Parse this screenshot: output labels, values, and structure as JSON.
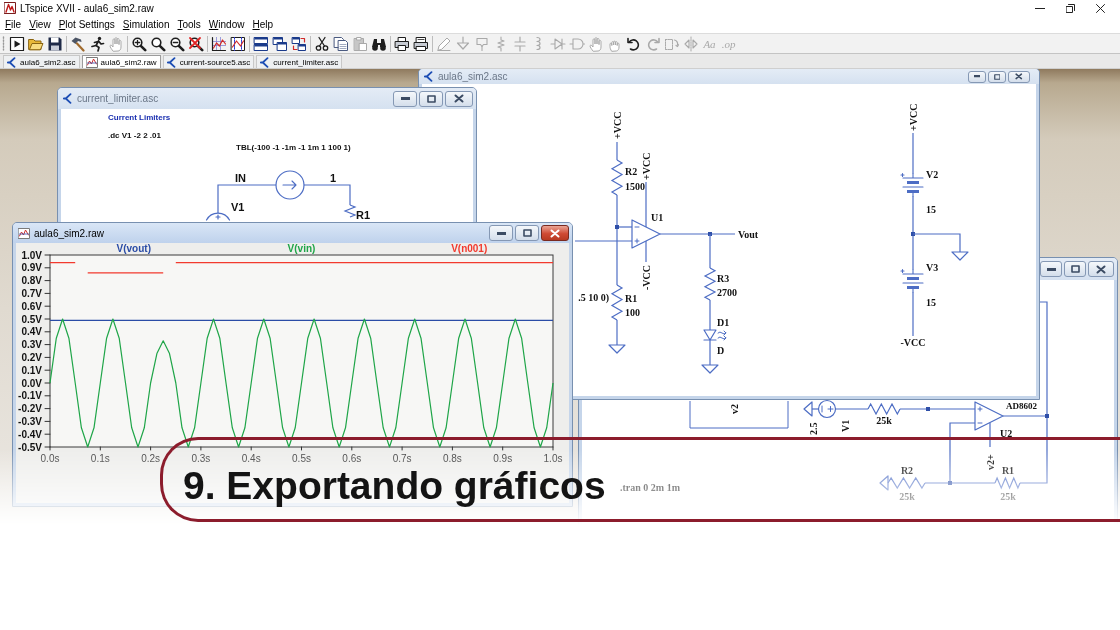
{
  "window": {
    "title": "LTspice XVII - aula6_sim2.raw"
  },
  "menu": [
    "File",
    "View",
    "Plot Settings",
    "Simulation",
    "Tools",
    "Window",
    "Help"
  ],
  "toolbar_groups": [
    [
      {
        "kind": "run",
        "disabled": false
      },
      {
        "kind": "open",
        "disabled": false
      },
      {
        "kind": "save",
        "disabled": false
      }
    ],
    [
      {
        "kind": "hammer",
        "disabled": false
      },
      {
        "kind": "runner",
        "disabled": false
      },
      {
        "kind": "hand",
        "disabled": true
      }
    ],
    [
      {
        "kind": "zoom_in",
        "disabled": false
      },
      {
        "kind": "zoom",
        "disabled": false
      },
      {
        "kind": "zoom_out",
        "disabled": false
      },
      {
        "kind": "zoom_cancel",
        "disabled": false
      }
    ],
    [
      {
        "kind": "autorange",
        "disabled": false
      },
      {
        "kind": "marker",
        "disabled": false
      }
    ],
    [
      {
        "kind": "tile",
        "disabled": false
      },
      {
        "kind": "cascade",
        "disabled": false
      },
      {
        "kind": "stack",
        "disabled": false
      }
    ],
    [
      {
        "kind": "cut",
        "disabled": false
      },
      {
        "kind": "copy",
        "disabled": false
      },
      {
        "kind": "paste",
        "disabled": true
      },
      {
        "kind": "find",
        "disabled": false
      }
    ],
    [
      {
        "kind": "print",
        "disabled": false
      },
      {
        "kind": "print_setup",
        "disabled": false
      }
    ],
    [
      {
        "kind": "pencil",
        "disabled": true
      },
      {
        "kind": "ground",
        "disabled": true
      },
      {
        "kind": "label",
        "disabled": true
      },
      {
        "kind": "resistor",
        "disabled": true
      },
      {
        "kind": "capacitor",
        "disabled": true
      },
      {
        "kind": "inductor",
        "disabled": true
      },
      {
        "kind": "diode",
        "disabled": true
      },
      {
        "kind": "component",
        "disabled": true
      },
      {
        "kind": "move",
        "disabled": true
      },
      {
        "kind": "drag",
        "disabled": true
      },
      {
        "kind": "undo",
        "disabled": false
      },
      {
        "kind": "redo",
        "disabled": true
      },
      {
        "kind": "rotate",
        "disabled": true
      },
      {
        "kind": "mirror",
        "disabled": true
      },
      {
        "kind": "text",
        "label": "Aa",
        "disabled": true
      },
      {
        "kind": "directive",
        "label": ".op",
        "disabled": true
      }
    ]
  ],
  "tabs": [
    {
      "label": "aula6_sim2.asc",
      "kind": "schematic",
      "selected": false
    },
    {
      "label": "aula6_sim2.raw",
      "kind": "plot",
      "selected": true
    },
    {
      "label": "current-source5.asc",
      "kind": "schematic",
      "selected": false
    },
    {
      "label": "current_limiter.asc",
      "kind": "schematic",
      "selected": false
    }
  ],
  "windows": [
    {
      "title": "aula6_sim2.asc",
      "kind": "schematic",
      "active": false,
      "texts": [
        {
          "text": "+VCC",
          "kind": "net"
        },
        {
          "text": "+VCC",
          "kind": "net"
        },
        {
          "text": "R2",
          "kind": "ref"
        },
        {
          "text": "1500",
          "kind": "value"
        },
        {
          "text": "+VCC",
          "kind": "net"
        },
        {
          "text": "U1",
          "kind": "ref"
        },
        {
          "text": "Vout",
          "kind": "net"
        },
        {
          "text": "V2",
          "kind": "ref"
        },
        {
          "text": "15",
          "kind": "value"
        },
        {
          "text": "-VCC",
          "kind": "net"
        },
        {
          "text": "V3",
          "kind": "ref"
        },
        {
          "text": "R3",
          "kind": "ref"
        },
        {
          "text": "2700",
          "kind": "value"
        },
        {
          "text": ".5 10 0)",
          "kind": "value"
        },
        {
          "text": "R1",
          "kind": "ref"
        },
        {
          "text": "15",
          "kind": "value"
        },
        {
          "text": "100",
          "kind": "value"
        },
        {
          "text": "D1",
          "kind": "ref"
        },
        {
          "text": "-VCC",
          "kind": "net"
        },
        {
          "text": "D",
          "kind": "value"
        }
      ]
    },
    {
      "title": "current_limiter.asc",
      "kind": "schematic",
      "active": false,
      "texts": [
        {
          "text": "Current Limiters",
          "kind": "comment"
        },
        {
          "text": ".dc V1 -2 2 .01",
          "kind": "directive"
        },
        {
          "text": "TBL(-100 -1 -1m -1 1m 1 100 1)",
          "kind": "value"
        },
        {
          "text": "IN",
          "kind": "net"
        },
        {
          "text": "1",
          "kind": "net"
        },
        {
          "text": "V1",
          "kind": "ref"
        },
        {
          "text": "R1",
          "kind": "ref"
        }
      ]
    },
    {
      "title": "aula6_sim2.raw",
      "kind": "plot",
      "active": true,
      "chart_data": {
        "type": "line",
        "x": [
          0,
          0.0125,
          0.025,
          0.0375,
          0.05,
          0.0625,
          0.075,
          0.0875,
          0.1,
          0.1125,
          0.125,
          0.1375,
          0.15,
          0.1625,
          0.175,
          0.1875,
          0.2,
          0.2125,
          0.225,
          0.2375,
          0.25,
          0.2625,
          0.275,
          0.2875,
          0.3,
          0.3125,
          0.325,
          0.3375,
          0.35,
          0.3625,
          0.375,
          0.3875,
          0.4,
          0.4125,
          0.425,
          0.4375,
          0.45,
          0.4625,
          0.475,
          0.4875,
          0.5,
          0.5125,
          0.525,
          0.5375,
          0.55,
          0.5625,
          0.575,
          0.5875,
          0.6,
          0.6125,
          0.625,
          0.6375,
          0.65,
          0.6625,
          0.675,
          0.6875,
          0.7,
          0.7125,
          0.725,
          0.7375,
          0.75,
          0.7625,
          0.775,
          0.7875,
          0.8,
          0.8125,
          0.825,
          0.8375,
          0.85,
          0.8625,
          0.875,
          0.8875,
          0.9,
          0.9125,
          0.925,
          0.9375,
          0.95,
          0.9625,
          0.975,
          0.9875,
          1
        ],
        "series": [
          {
            "name": "V(vout)",
            "color": "#2a4ca6",
            "values": [
              0.49,
              0.49,
              0.49,
              0.49,
              0.49,
              0.49,
              0.49,
              0.49,
              0.49,
              0.49,
              0.49,
              0.49,
              0.49,
              0.49,
              0.49,
              0.49,
              0.49,
              0.49,
              0.49,
              0.49,
              0.49,
              0.49,
              0.49,
              0.49,
              0.49,
              0.49,
              0.49,
              0.49,
              0.49,
              0.49,
              0.49,
              0.49,
              0.49,
              0.49,
              0.49,
              0.49,
              0.49,
              0.49,
              0.49,
              0.49,
              0.49,
              0.49,
              0.49,
              0.49,
              0.49,
              0.49,
              0.49,
              0.49,
              0.49,
              0.49,
              0.49,
              0.49,
              0.49,
              0.49,
              0.49,
              0.49,
              0.49,
              0.49,
              0.49,
              0.49,
              0.49,
              0.49,
              0.49,
              0.49,
              0.49,
              0.49,
              0.49,
              0.49,
              0.49,
              0.49,
              0.49,
              0.49,
              0.49,
              0.49,
              0.49,
              0.49,
              0.49,
              0.49,
              0.49,
              0.49,
              0.49
            ]
          },
          {
            "name": "V(vin)",
            "color": "#1fa548",
            "values": [
              0,
              0.35,
              0.5,
              0.35,
              0,
              -0.35,
              -0.5,
              -0.35,
              0,
              0.35,
              0.5,
              0.35,
              0,
              -0.35,
              -0.5,
              -0.35,
              0,
              0.23,
              0.33,
              0.23,
              0,
              -0.35,
              -0.5,
              -0.35,
              0,
              0.35,
              0.5,
              0.35,
              0,
              -0.35,
              -0.5,
              -0.35,
              0,
              0.35,
              0.5,
              0.35,
              0,
              -0.35,
              -0.5,
              -0.35,
              0,
              0.35,
              0.5,
              0.35,
              0,
              -0.35,
              -0.5,
              -0.35,
              0,
              0.35,
              0.5,
              0.35,
              0,
              -0.35,
              -0.5,
              -0.35,
              0,
              0.35,
              0.5,
              0.35,
              0,
              -0.35,
              -0.5,
              -0.35,
              0,
              0.35,
              0.5,
              0.35,
              0,
              -0.35,
              -0.5,
              -0.35,
              0,
              0.35,
              0.5,
              0.35,
              0,
              -0.35,
              -0.5,
              -0.35,
              0
            ]
          },
          {
            "name": "V(n001)",
            "color": "#f23a2e",
            "values": [
              0.94,
              0.94,
              0.94,
              0.94,
              0.94,
              null,
              0.86,
              0.86,
              0.86,
              0.86,
              0.86,
              0.86,
              0.86,
              0.86,
              0.86,
              0.86,
              0.86,
              0.86,
              0.86,
              null,
              0.94,
              0.94,
              0.94,
              0.94,
              0.94,
              0.94,
              0.94,
              0.94,
              0.94,
              0.94,
              0.94,
              0.94,
              0.94,
              0.94,
              0.94,
              0.94,
              0.94,
              0.94,
              0.94,
              0.94,
              0.94,
              0.94,
              0.94,
              0.94,
              0.94,
              0.94,
              0.94,
              0.94,
              0.94,
              0.94,
              0.94,
              0.94,
              0.94,
              0.94,
              0.94,
              0.94,
              0.94,
              0.94,
              0.94,
              0.94,
              0.94,
              0.94,
              0.94,
              0.94,
              0.94,
              0.94,
              0.94,
              0.94,
              0.94,
              0.94,
              0.94,
              0.94,
              0.94,
              0.94,
              0.94,
              0.94,
              0.94,
              0.94,
              0.94,
              0.94,
              0.94
            ]
          }
        ],
        "xlim": [
          0,
          1
        ],
        "ylim": [
          -0.5,
          1.0
        ],
        "xticks": [
          {
            "value": 0,
            "label": "0.0s"
          },
          {
            "value": 0.1,
            "label": "0.1s"
          },
          {
            "value": 0.2,
            "label": "0.2s"
          },
          {
            "value": 0.3,
            "label": "0.3s"
          },
          {
            "value": 0.4,
            "label": "0.4s"
          },
          {
            "value": 0.5,
            "label": "0.5s"
          },
          {
            "value": 0.6,
            "label": "0.6s"
          },
          {
            "value": 0.7,
            "label": "0.7s"
          },
          {
            "value": 0.8,
            "label": "0.8s"
          },
          {
            "value": 0.9,
            "label": "0.9s"
          },
          {
            "value": 1,
            "label": "1.0s"
          }
        ],
        "yticks": [
          {
            "value": 1.0,
            "label": "1.0V"
          },
          {
            "value": 0.9,
            "label": "0.9V"
          },
          {
            "value": 0.8,
            "label": "0.8V"
          },
          {
            "value": 0.7,
            "label": "0.7V"
          },
          {
            "value": 0.6,
            "label": "0.6V"
          },
          {
            "value": 0.5,
            "label": "0.5V"
          },
          {
            "value": 0.4,
            "label": "0.4V"
          },
          {
            "value": 0.3,
            "label": "0.3V"
          },
          {
            "value": 0.2,
            "label": "0.2V"
          },
          {
            "value": 0.1,
            "label": "0.1V"
          },
          {
            "value": 0,
            "label": "0.0V"
          },
          {
            "value": -0.1,
            "label": "-0.1V"
          },
          {
            "value": -0.2,
            "label": "-0.2V"
          },
          {
            "value": -0.3,
            "label": "-0.3V"
          },
          {
            "value": -0.4,
            "label": "-0.4V"
          },
          {
            "value": -0.5,
            "label": "-0.5V"
          }
        ]
      }
    },
    {
      "kind": "schematic",
      "active": false,
      "texts": [
        {
          "text": "v2",
          "kind": "net"
        },
        {
          "text": "AD8602",
          "kind": "value"
        },
        {
          "text": "25k",
          "kind": "value"
        },
        {
          "text": "2.5",
          "kind": "value"
        },
        {
          "text": "V1",
          "kind": "ref"
        },
        {
          "text": "U2",
          "kind": "ref"
        },
        {
          "text": "v2+",
          "kind": "net"
        },
        {
          "text": "R2",
          "kind": "ref"
        },
        {
          "text": "R1",
          "kind": "ref"
        },
        {
          "text": ".tran 0 2m 1m",
          "kind": "directive"
        },
        {
          "text": "25k",
          "kind": "value"
        },
        {
          "text": "25k",
          "kind": "value"
        }
      ]
    }
  ],
  "banner": {
    "title": "9. Exportando gráficos"
  }
}
